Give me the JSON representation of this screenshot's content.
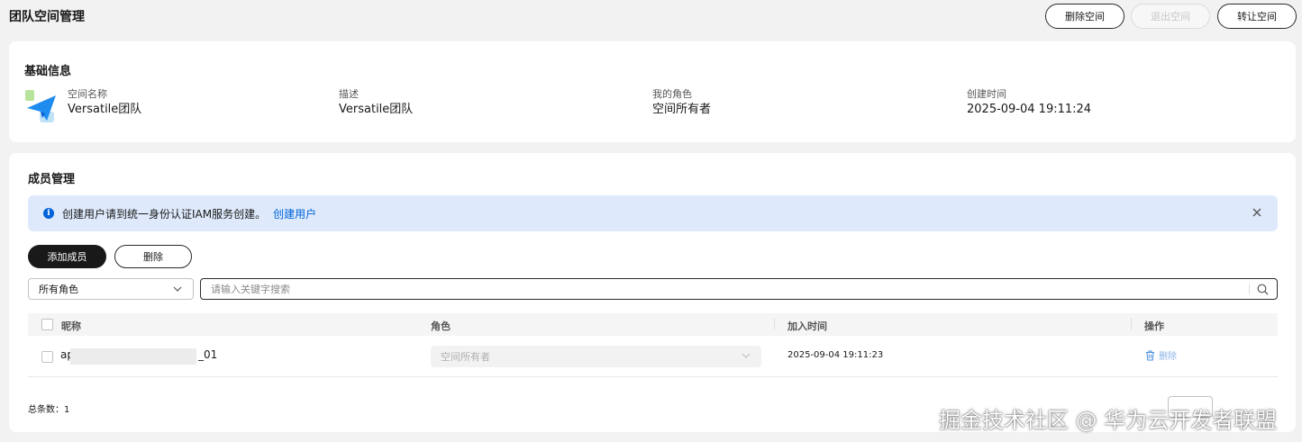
{
  "header": {
    "title": "团队空间管理",
    "delete_space": "删除空间",
    "exit_space": "退出空间",
    "transfer_space": "转让空间"
  },
  "basic_info": {
    "title": "基础信息",
    "items": [
      {
        "label": "空间名称",
        "value": "Versatile团队"
      },
      {
        "label": "描述",
        "value": "Versatile团队"
      },
      {
        "label": "我的角色",
        "value": "空间所有者"
      },
      {
        "label": "创建时间",
        "value": "2025-09-04 19:11:24"
      }
    ]
  },
  "members": {
    "title": "成员管理",
    "alert": {
      "icon": "info-icon",
      "text": "创建用户请到统一身份认证IAM服务创建。",
      "link": "创建用户"
    },
    "add_button": "添加成员",
    "delete_button": "删除",
    "role_filter": "所有角色",
    "search_placeholder": "请输入关键字搜索",
    "columns": [
      "昵称",
      "角色",
      "加入时间",
      "操作"
    ],
    "rows": [
      {
        "name_prefix": "ap",
        "name_suffix": "_01",
        "role": "空间所有者",
        "join_time": "2025-09-04 19:11:23",
        "action": "删除"
      }
    ],
    "total_label": "总条数：",
    "total": "1"
  },
  "watermark": "掘金技术社区 @ 华为云开发者联盟",
  "colors": {
    "primary_dark": "#191919",
    "link_blue": "#0062d9",
    "alert_bg": "#deeafb"
  }
}
